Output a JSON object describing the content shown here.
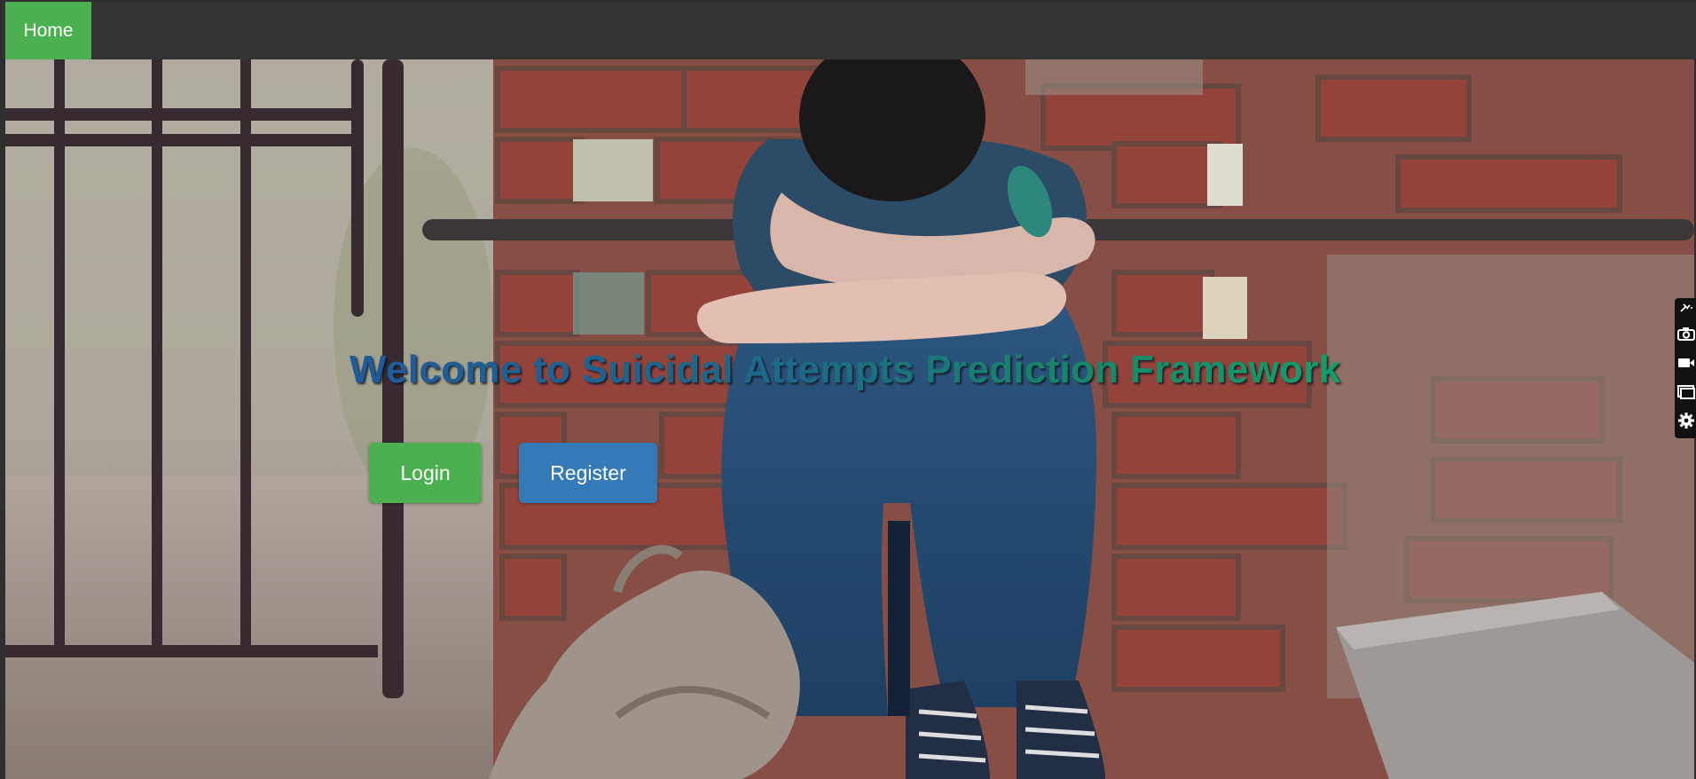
{
  "navbar": {
    "home_label": "Home"
  },
  "hero": {
    "title": "Welcome to Suicidal Attempts Prediction Framework",
    "background_image": "person-sitting-against-brick-wall-photo"
  },
  "actions": {
    "login_label": "Login",
    "register_label": "Register"
  },
  "side_toolbar": {
    "icons": [
      "pin-icon",
      "camera-icon",
      "video-icon",
      "screen-icon",
      "gear-icon"
    ]
  },
  "colors": {
    "navbar": "#333333",
    "home_active": "#4caf50",
    "login_button": "#4cb050",
    "register_button": "#337ab7",
    "title_start": "#1e5a9e",
    "title_end": "#13a06a"
  }
}
